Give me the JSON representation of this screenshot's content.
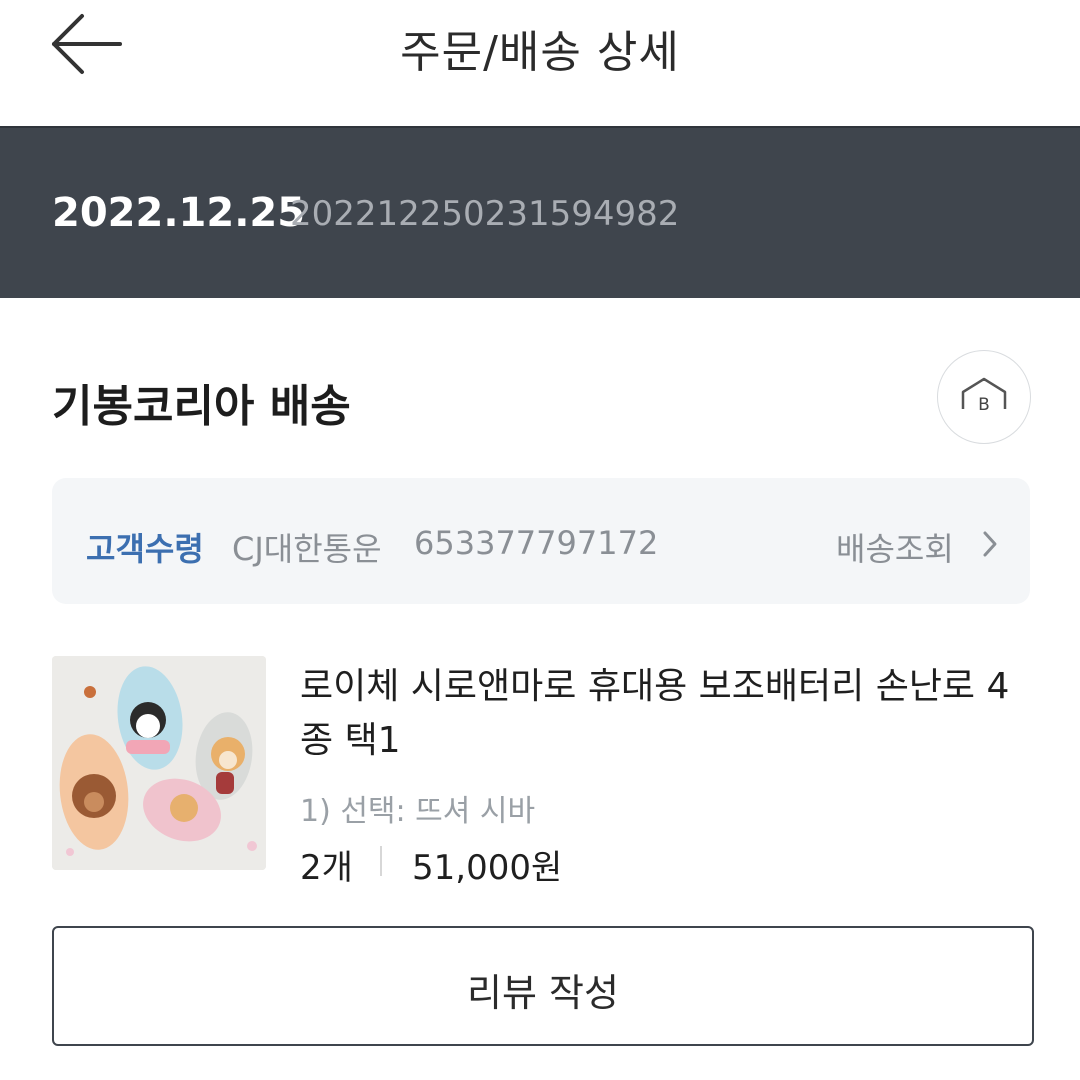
{
  "header": {
    "title": "주문/배송 상세",
    "back_icon": "arrow-left-icon"
  },
  "order": {
    "date": "2022.12.25",
    "number": "20221225023159498​2"
  },
  "seller": {
    "name": "기봉코리아 배송",
    "store_icon_letter": "B"
  },
  "shipping": {
    "status": "고객수령",
    "carrier": "CJ대한통운",
    "tracking_number": "653377797172",
    "track_label": "배송조회"
  },
  "product": {
    "name": "로이체 시로앤마로 휴대용 보조배터리 손난로 4종 택1",
    "option": "1) 선택: 뜨셔 시바",
    "quantity": "2개",
    "price": "51,000원"
  },
  "actions": {
    "review_label": "리뷰 작성"
  },
  "colors": {
    "band": "#3f454d",
    "status_blue": "#3c6fb0",
    "muted": "#8a8f95"
  }
}
